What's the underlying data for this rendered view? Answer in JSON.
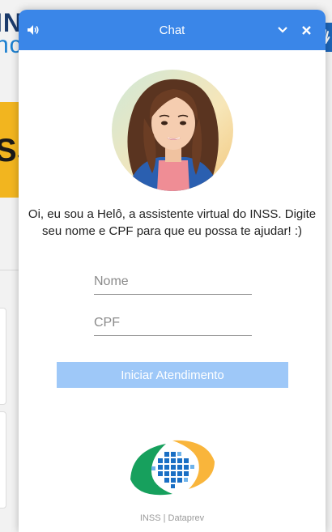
{
  "background": {
    "title_line1": "INS",
    "title_line2": "nc",
    "banner_text": "SS"
  },
  "chat": {
    "title": "Chat",
    "sound_icon": "speaker-icon",
    "minimize_icon": "chevron-down-icon",
    "close_icon": "close-icon",
    "greeting": "Oi, eu sou a Helô, a assistente virtual do INSS. Digite seu nome e CPF para que eu possa te ajudar! :)",
    "name_placeholder": "Nome",
    "cpf_placeholder": "CPF",
    "start_button": "Iniciar Atendimento",
    "footer": "INSS | Dataprev"
  },
  "colors": {
    "header": "#3a86e8",
    "button": "#9ec8f8",
    "logo_green": "#17a05d",
    "logo_yellow": "#f9b53b",
    "logo_blue": "#1a6fc4"
  }
}
